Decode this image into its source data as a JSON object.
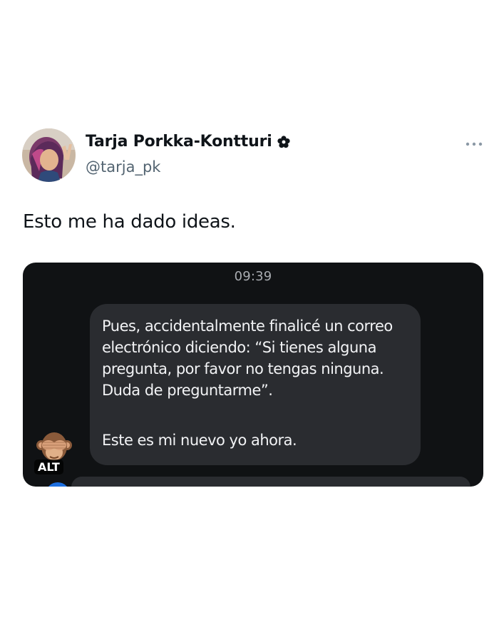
{
  "tweet": {
    "author_name": "Tarja Porkka-Kontturi",
    "handle": "@tarja_pk",
    "text": "Esto me ha dado ideas.",
    "more_icon": "more-horizontal-icon",
    "badge_icon": "flower-icon"
  },
  "media": {
    "time": "09:39",
    "message_1": "Pues, accidentalmente finalicé un correo electrónico diciendo: “Si tienes alguna pregunta, por favor no tengas ninguna. Duda de preguntarme”.",
    "message_2": "Este es mi nuevo yo ahora.",
    "alt_label": "ALT",
    "reaction_icon": "see-no-evil-monkey-icon"
  },
  "colors": {
    "media_background": "#101214",
    "bubble_background": "#2a2c30",
    "handle_gray": "#536471",
    "accent_blue": "#1d6fe0"
  }
}
